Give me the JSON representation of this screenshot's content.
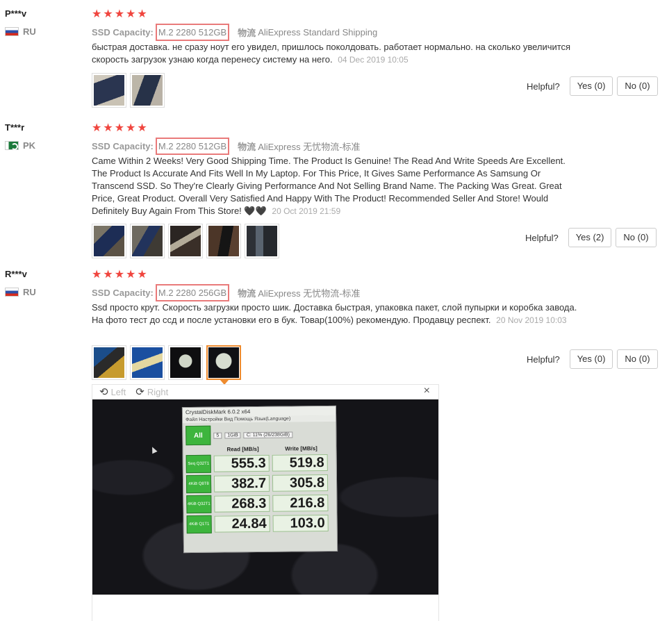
{
  "attr_label": "SSD Capacity:",
  "ship_label": "物流",
  "helpful_label": "Helpful?",
  "reviews": [
    {
      "user": "P***v",
      "country": "RU",
      "stars": "★★★★★",
      "capacity": "M.2 2280 512GB",
      "shipping": "AliExpress Standard Shipping",
      "text": "быстрая доставка. не сразу ноут его увидел, пришлось поколдовать. работает нормально. на сколько увеличится скорость загрузок узнаю когда перенесу систему на него.",
      "date": "04 Dec 2019 10:05",
      "yes": "Yes (0)",
      "no": "No (0)"
    },
    {
      "user": "T***r",
      "country": "PK",
      "stars": "★★★★★",
      "capacity": "M.2 2280 512GB",
      "shipping": "AliExpress 无忧物流-标准",
      "text": "Came Within 2 Weeks! Very Good Shipping Time. The Product Is Genuine! The Read And Write Speeds Are Excellent. The Product Is Accurate And Fits Well In My Laptop. For This Price, It Gives Same Performance As Samsung Or Transcend SSD. So They're Clearly Giving Performance And Not Selling Brand Name. The Packing Was Great. Great Price, Great Product. Overall Very Satisfied And Happy With The Product! Recommended Seller And Store! Would Definitely Buy Again From This Store! 🖤🖤",
      "date": "20 Oct 2019 21:59",
      "yes": "Yes (2)",
      "no": "No (0)"
    },
    {
      "user": "R***v",
      "country": "RU",
      "stars": "★★★★★",
      "capacity": "M.2 2280 256GB",
      "shipping": "AliExpress 无忧物流-标准",
      "text": "Ssd просто крут. Скорость загрузки просто шик. Доставка быстрая, упаковка пакет, слой пупырки и коробка завода. На фото тест до ссд и после установки его в бук. Товар(100%) рекомендую. Продавцу респект.",
      "date": "20 Nov 2019 10:03",
      "yes": "Yes (0)",
      "no": "No (0)"
    }
  ],
  "viewer": {
    "left": "Left",
    "right": "Right",
    "close": "×",
    "cdm": {
      "title": "CrystalDiskMark 6.0.2 x64",
      "menu": "Файл  Настройки  Вид  Помощь  Язык(Language)",
      "all": "All",
      "runs": "5",
      "size": "1GiB",
      "drive": "C: 11% (26/238GiB)",
      "read_h": "Read [MB/s]",
      "write_h": "Write [MB/s]",
      "rows": [
        {
          "label": "Seq Q32T1",
          "read": "555.3",
          "write": "519.8"
        },
        {
          "label": "4KiB Q8T8",
          "read": "382.7",
          "write": "305.8"
        },
        {
          "label": "4KiB Q32T1",
          "read": "268.3",
          "write": "216.8"
        },
        {
          "label": "4KiB Q1T1",
          "read": "24.84",
          "write": "103.0"
        }
      ]
    }
  }
}
